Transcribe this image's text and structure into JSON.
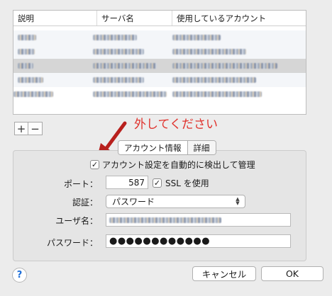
{
  "table": {
    "columns": [
      "説明",
      "サーバ名",
      "使用しているアカウント"
    ],
    "row_count": 5,
    "selected_row": 2
  },
  "list_controls": {
    "add": "+",
    "remove": "−"
  },
  "annotation": {
    "text": "外してください",
    "color": "#e0322d"
  },
  "tabs": [
    {
      "label": "アカウント情報",
      "selected": true
    },
    {
      "label": "詳細",
      "selected": false
    }
  ],
  "auto_manage": {
    "label": "アカウント設定を自動的に検出して管理",
    "checked": true
  },
  "port": {
    "label": "ポート：",
    "value": "587"
  },
  "ssl": {
    "label": "SSL を使用",
    "checked": true
  },
  "auth": {
    "label": "認証：",
    "value": "パスワード"
  },
  "username": {
    "label": "ユーザ名："
  },
  "password": {
    "label": "パスワード：",
    "value": "●●●●●●●●●●●●"
  },
  "buttons": {
    "help": "?",
    "cancel": "キャンセル",
    "ok": "OK"
  }
}
